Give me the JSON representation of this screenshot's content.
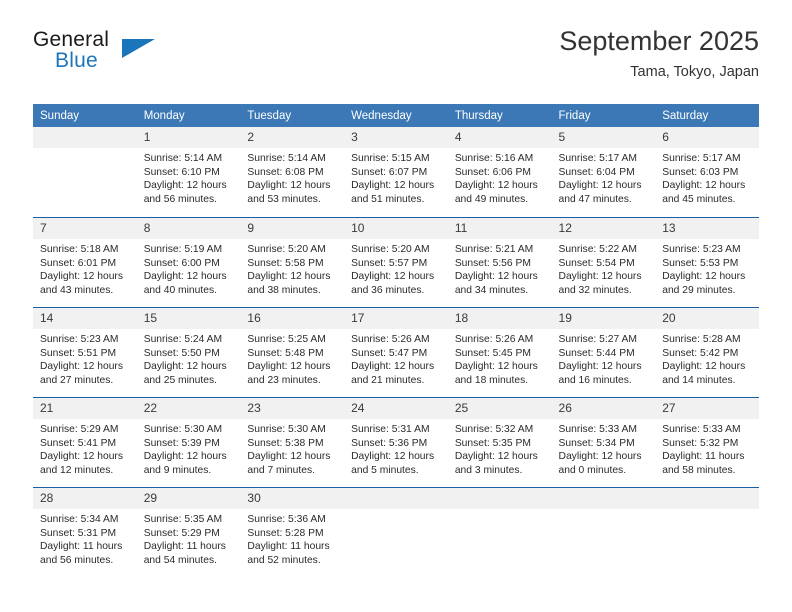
{
  "brand": {
    "name_top": "General",
    "name_bottom": "Blue",
    "accent_color": "#1b75bb"
  },
  "header": {
    "title": "September 2025",
    "subtitle": "Tama, Tokyo, Japan"
  },
  "theme": {
    "header_bg": "#3b78b5",
    "row_divider": "#1b5ea6",
    "daynum_bg": "#f1f1f1"
  },
  "weekday_headers": [
    "Sunday",
    "Monday",
    "Tuesday",
    "Wednesday",
    "Thursday",
    "Friday",
    "Saturday"
  ],
  "weeks": [
    [
      {
        "day": "",
        "sunrise": "",
        "sunset": "",
        "daylight": "",
        "empty": true
      },
      {
        "day": "1",
        "sunrise": "Sunrise: 5:14 AM",
        "sunset": "Sunset: 6:10 PM",
        "daylight": "Daylight: 12 hours and 56 minutes."
      },
      {
        "day": "2",
        "sunrise": "Sunrise: 5:14 AM",
        "sunset": "Sunset: 6:08 PM",
        "daylight": "Daylight: 12 hours and 53 minutes."
      },
      {
        "day": "3",
        "sunrise": "Sunrise: 5:15 AM",
        "sunset": "Sunset: 6:07 PM",
        "daylight": "Daylight: 12 hours and 51 minutes."
      },
      {
        "day": "4",
        "sunrise": "Sunrise: 5:16 AM",
        "sunset": "Sunset: 6:06 PM",
        "daylight": "Daylight: 12 hours and 49 minutes."
      },
      {
        "day": "5",
        "sunrise": "Sunrise: 5:17 AM",
        "sunset": "Sunset: 6:04 PM",
        "daylight": "Daylight: 12 hours and 47 minutes."
      },
      {
        "day": "6",
        "sunrise": "Sunrise: 5:17 AM",
        "sunset": "Sunset: 6:03 PM",
        "daylight": "Daylight: 12 hours and 45 minutes."
      }
    ],
    [
      {
        "day": "7",
        "sunrise": "Sunrise: 5:18 AM",
        "sunset": "Sunset: 6:01 PM",
        "daylight": "Daylight: 12 hours and 43 minutes."
      },
      {
        "day": "8",
        "sunrise": "Sunrise: 5:19 AM",
        "sunset": "Sunset: 6:00 PM",
        "daylight": "Daylight: 12 hours and 40 minutes."
      },
      {
        "day": "9",
        "sunrise": "Sunrise: 5:20 AM",
        "sunset": "Sunset: 5:58 PM",
        "daylight": "Daylight: 12 hours and 38 minutes."
      },
      {
        "day": "10",
        "sunrise": "Sunrise: 5:20 AM",
        "sunset": "Sunset: 5:57 PM",
        "daylight": "Daylight: 12 hours and 36 minutes."
      },
      {
        "day": "11",
        "sunrise": "Sunrise: 5:21 AM",
        "sunset": "Sunset: 5:56 PM",
        "daylight": "Daylight: 12 hours and 34 minutes."
      },
      {
        "day": "12",
        "sunrise": "Sunrise: 5:22 AM",
        "sunset": "Sunset: 5:54 PM",
        "daylight": "Daylight: 12 hours and 32 minutes."
      },
      {
        "day": "13",
        "sunrise": "Sunrise: 5:23 AM",
        "sunset": "Sunset: 5:53 PM",
        "daylight": "Daylight: 12 hours and 29 minutes."
      }
    ],
    [
      {
        "day": "14",
        "sunrise": "Sunrise: 5:23 AM",
        "sunset": "Sunset: 5:51 PM",
        "daylight": "Daylight: 12 hours and 27 minutes."
      },
      {
        "day": "15",
        "sunrise": "Sunrise: 5:24 AM",
        "sunset": "Sunset: 5:50 PM",
        "daylight": "Daylight: 12 hours and 25 minutes."
      },
      {
        "day": "16",
        "sunrise": "Sunrise: 5:25 AM",
        "sunset": "Sunset: 5:48 PM",
        "daylight": "Daylight: 12 hours and 23 minutes."
      },
      {
        "day": "17",
        "sunrise": "Sunrise: 5:26 AM",
        "sunset": "Sunset: 5:47 PM",
        "daylight": "Daylight: 12 hours and 21 minutes."
      },
      {
        "day": "18",
        "sunrise": "Sunrise: 5:26 AM",
        "sunset": "Sunset: 5:45 PM",
        "daylight": "Daylight: 12 hours and 18 minutes."
      },
      {
        "day": "19",
        "sunrise": "Sunrise: 5:27 AM",
        "sunset": "Sunset: 5:44 PM",
        "daylight": "Daylight: 12 hours and 16 minutes."
      },
      {
        "day": "20",
        "sunrise": "Sunrise: 5:28 AM",
        "sunset": "Sunset: 5:42 PM",
        "daylight": "Daylight: 12 hours and 14 minutes."
      }
    ],
    [
      {
        "day": "21",
        "sunrise": "Sunrise: 5:29 AM",
        "sunset": "Sunset: 5:41 PM",
        "daylight": "Daylight: 12 hours and 12 minutes."
      },
      {
        "day": "22",
        "sunrise": "Sunrise: 5:30 AM",
        "sunset": "Sunset: 5:39 PM",
        "daylight": "Daylight: 12 hours and 9 minutes."
      },
      {
        "day": "23",
        "sunrise": "Sunrise: 5:30 AM",
        "sunset": "Sunset: 5:38 PM",
        "daylight": "Daylight: 12 hours and 7 minutes."
      },
      {
        "day": "24",
        "sunrise": "Sunrise: 5:31 AM",
        "sunset": "Sunset: 5:36 PM",
        "daylight": "Daylight: 12 hours and 5 minutes."
      },
      {
        "day": "25",
        "sunrise": "Sunrise: 5:32 AM",
        "sunset": "Sunset: 5:35 PM",
        "daylight": "Daylight: 12 hours and 3 minutes."
      },
      {
        "day": "26",
        "sunrise": "Sunrise: 5:33 AM",
        "sunset": "Sunset: 5:34 PM",
        "daylight": "Daylight: 12 hours and 0 minutes."
      },
      {
        "day": "27",
        "sunrise": "Sunrise: 5:33 AM",
        "sunset": "Sunset: 5:32 PM",
        "daylight": "Daylight: 11 hours and 58 minutes."
      }
    ],
    [
      {
        "day": "28",
        "sunrise": "Sunrise: 5:34 AM",
        "sunset": "Sunset: 5:31 PM",
        "daylight": "Daylight: 11 hours and 56 minutes."
      },
      {
        "day": "29",
        "sunrise": "Sunrise: 5:35 AM",
        "sunset": "Sunset: 5:29 PM",
        "daylight": "Daylight: 11 hours and 54 minutes."
      },
      {
        "day": "30",
        "sunrise": "Sunrise: 5:36 AM",
        "sunset": "Sunset: 5:28 PM",
        "daylight": "Daylight: 11 hours and 52 minutes."
      },
      {
        "day": "",
        "sunrise": "",
        "sunset": "",
        "daylight": "",
        "empty": true
      },
      {
        "day": "",
        "sunrise": "",
        "sunset": "",
        "daylight": "",
        "empty": true
      },
      {
        "day": "",
        "sunrise": "",
        "sunset": "",
        "daylight": "",
        "empty": true
      },
      {
        "day": "",
        "sunrise": "",
        "sunset": "",
        "daylight": "",
        "empty": true
      }
    ]
  ]
}
